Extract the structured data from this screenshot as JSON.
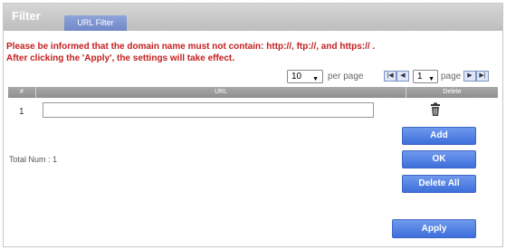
{
  "header": {
    "title": "Filter",
    "tab_label": "URL Filter"
  },
  "notices": [
    "Please be informed that the domain name must not contain: http://, ftp://, and https:// .",
    "After clicking the 'Apply', the settings will take effect."
  ],
  "pagination": {
    "per_page_value": "10",
    "per_page_label": "per page",
    "page_value": "1",
    "page_label": "page"
  },
  "table": {
    "headers": {
      "num": "#",
      "url": "URL",
      "delete": "Delete"
    },
    "rows": [
      {
        "num": "1",
        "url": ""
      }
    ]
  },
  "buttons": {
    "add": "Add",
    "ok": "OK",
    "delete_all": "Delete All",
    "apply": "Apply"
  },
  "total": "Total Num : 1",
  "colors": {
    "notice": "#c41e1e",
    "button": "#3d6fd9",
    "tab": "#7a92d0"
  }
}
